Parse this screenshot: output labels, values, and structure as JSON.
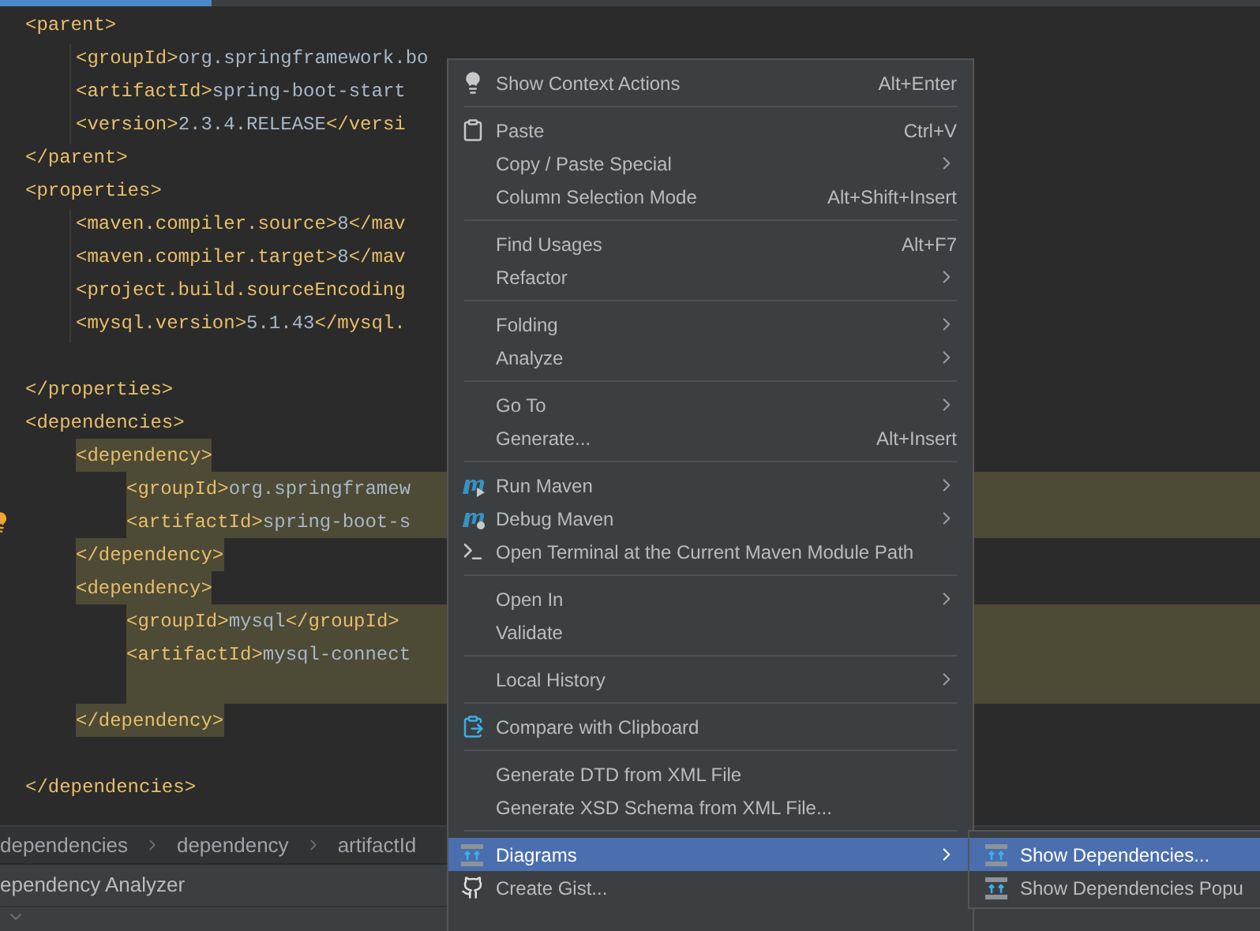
{
  "editor": {
    "lines": [
      {
        "kind": "code",
        "text": "<parent>",
        "selected": false,
        "children": [
          {
            "kind": "code",
            "text": "<groupId>org.springframework.bo",
            "selected": false
          },
          {
            "kind": "code",
            "text": "<artifactId>spring-boot-start",
            "selected": false
          },
          {
            "kind": "code",
            "text": "<version>2.3.4.RELEASE</versi",
            "selected": false
          }
        ]
      },
      {
        "kind": "code",
        "text": "</parent>",
        "selected": false
      },
      {
        "kind": "code",
        "text": "<properties>",
        "selected": false,
        "children": [
          {
            "kind": "code",
            "text": "<maven.compiler.source>8</mav",
            "selected": false
          },
          {
            "kind": "code",
            "text": "<maven.compiler.target>8</mav",
            "selected": false
          },
          {
            "kind": "code",
            "text": "<project.build.sourceEncoding",
            "selected": false
          },
          {
            "kind": "code",
            "text": "<mysql.version>5.1.43</mysql.",
            "selected": false
          }
        ]
      },
      {
        "kind": "blank"
      },
      {
        "kind": "code",
        "text": "</properties>",
        "selected": false
      },
      {
        "kind": "code",
        "text": "<dependencies>",
        "selected": false,
        "children": [
          {
            "kind": "code",
            "text": "<dependency>",
            "selected": true,
            "partial": true,
            "children": [
              {
                "kind": "code",
                "text": "<groupId>org.springframew",
                "selected": true,
                "partial": false
              },
              {
                "kind": "code",
                "text": "<artifactId>spring-boot-s",
                "selected": true,
                "partial": false,
                "bulb": true
              }
            ]
          },
          {
            "kind": "code",
            "text": "</dependency>",
            "selected": true,
            "partial": true
          },
          {
            "kind": "code",
            "text": "<dependency>",
            "selected": true,
            "partial": true,
            "children": [
              {
                "kind": "code",
                "text": "<groupId>mysql</groupId>",
                "selected": true,
                "partial": false
              },
              {
                "kind": "code",
                "text": "<artifactId>mysql-connect",
                "selected": true,
                "partial": false
              },
              {
                "kind": "selected_blank",
                "selected": true,
                "partial": false
              }
            ]
          },
          {
            "kind": "code",
            "text": "</dependency>",
            "selected": true,
            "partial": true
          }
        ]
      },
      {
        "kind": "blank"
      },
      {
        "kind": "code",
        "text": "</dependencies>",
        "selected": false
      }
    ]
  },
  "breadcrumbs": [
    "dependencies",
    "dependency",
    "artifactId"
  ],
  "tool_window": {
    "title": "ependency Analyzer"
  },
  "context_menu": {
    "groups": [
      [
        {
          "label": "Show Context Actions",
          "shortcut": "Alt+Enter",
          "has_submenu": false,
          "selected": false
        }
      ],
      [
        {
          "label": "Paste",
          "shortcut": "Ctrl+V",
          "has_submenu": false,
          "selected": false
        },
        {
          "label": "Copy / Paste Special",
          "has_submenu": true,
          "selected": false
        },
        {
          "label": "Column Selection Mode",
          "shortcut": "Alt+Shift+Insert",
          "has_submenu": false,
          "selected": false
        }
      ],
      [
        {
          "label": "Find Usages",
          "shortcut": "Alt+F7",
          "has_submenu": false,
          "selected": false
        },
        {
          "label": "Refactor",
          "has_submenu": true,
          "selected": false
        }
      ],
      [
        {
          "label": "Folding",
          "has_submenu": true,
          "selected": false
        },
        {
          "label": "Analyze",
          "has_submenu": true,
          "selected": false
        }
      ],
      [
        {
          "label": "Go To",
          "has_submenu": true,
          "selected": false
        },
        {
          "label": "Generate...",
          "shortcut": "Alt+Insert",
          "has_submenu": false,
          "selected": false
        }
      ],
      [
        {
          "label": "Run Maven",
          "has_submenu": true,
          "selected": false
        },
        {
          "label": "Debug Maven",
          "has_submenu": true,
          "selected": false
        },
        {
          "label": "Open Terminal at the Current Maven Module Path",
          "has_submenu": false,
          "selected": false
        }
      ],
      [
        {
          "label": "Open In",
          "has_submenu": true,
          "selected": false
        },
        {
          "label": "Validate",
          "has_submenu": false,
          "selected": false
        }
      ],
      [
        {
          "label": "Local History",
          "has_submenu": true,
          "selected": false
        }
      ],
      [
        {
          "label": "Compare with Clipboard",
          "has_submenu": false,
          "selected": false
        }
      ],
      [
        {
          "label": "Generate DTD from XML File",
          "has_submenu": false,
          "selected": false
        },
        {
          "label": "Generate XSD Schema from XML File...",
          "has_submenu": false,
          "selected": false
        }
      ],
      [
        {
          "label": "Diagrams",
          "has_submenu": true,
          "selected": true
        },
        {
          "label": "Create Gist...",
          "has_submenu": false,
          "selected": false
        }
      ]
    ]
  },
  "submenu": {
    "items": [
      {
        "label": "Show Dependencies...",
        "selected": true
      },
      {
        "label": "Show Dependencies Popu",
        "selected": false
      }
    ]
  }
}
